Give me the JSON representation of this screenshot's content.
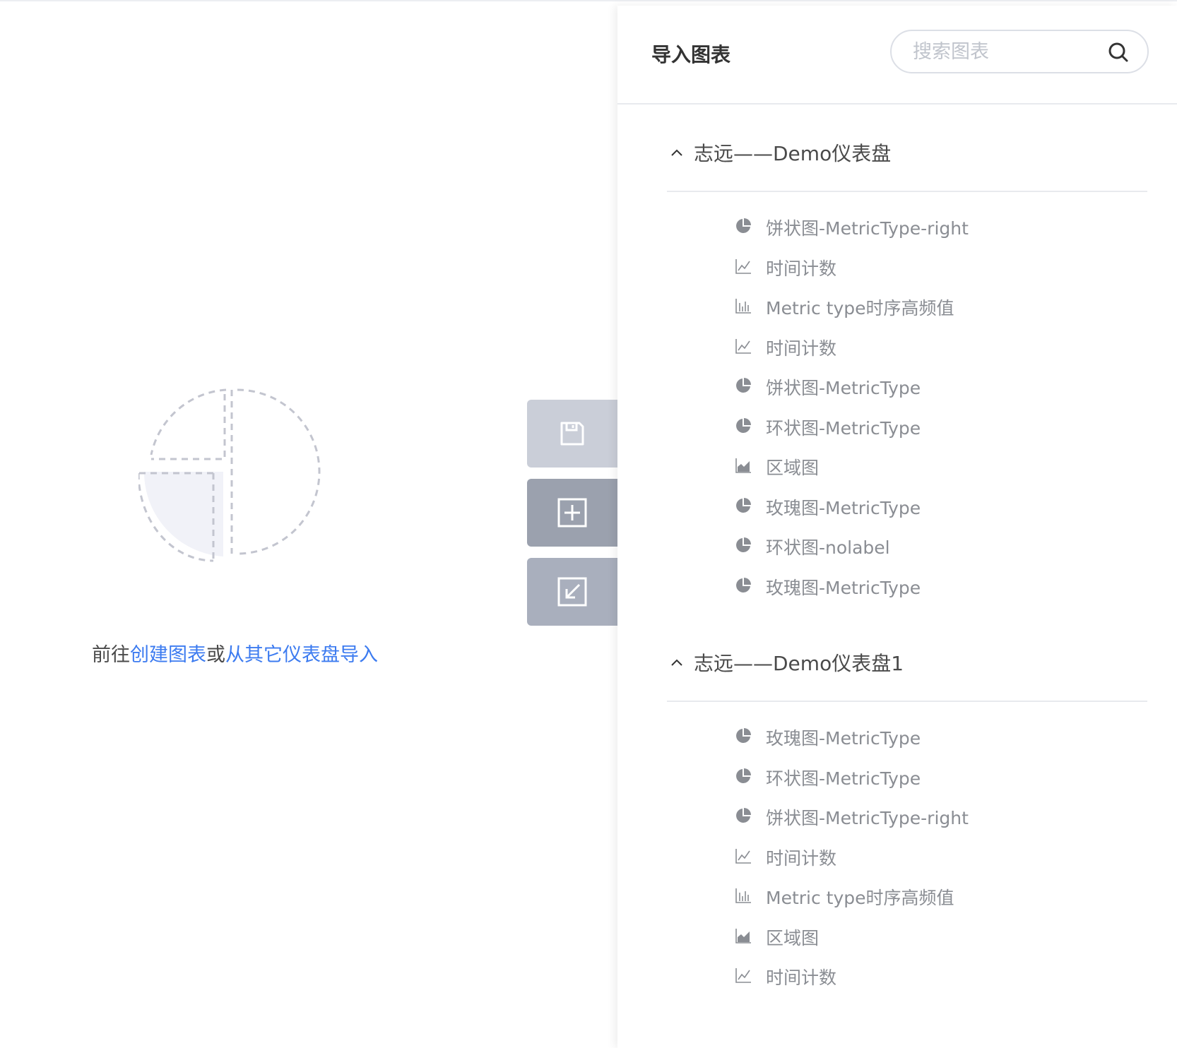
{
  "empty_state": {
    "prefix": "前往",
    "create_link": "创建图表",
    "or_text": "或",
    "import_link": "从其它仪表盘导入"
  },
  "toolbar": {
    "buttons": [
      {
        "icon": "save-icon"
      },
      {
        "icon": "plus-square-icon"
      },
      {
        "icon": "import-arrow-icon"
      }
    ]
  },
  "panel": {
    "title": "导入图表",
    "search": {
      "placeholder": "搜索图表",
      "value": ""
    },
    "groups": [
      {
        "title": "志远——Demo仪表盘",
        "expanded": true,
        "items": [
          {
            "label": "饼状图-MetricType-right",
            "icon": "pie-icon"
          },
          {
            "label": "时间计数",
            "icon": "line-chart-icon"
          },
          {
            "label": "Metric type时序高频值",
            "icon": "bar-chart-icon"
          },
          {
            "label": "时间计数",
            "icon": "line-chart-icon"
          },
          {
            "label": "饼状图-MetricType",
            "icon": "pie-icon"
          },
          {
            "label": "环状图-MetricType",
            "icon": "pie-icon"
          },
          {
            "label": "区域图",
            "icon": "area-chart-icon"
          },
          {
            "label": "玫瑰图-MetricType",
            "icon": "pie-icon"
          },
          {
            "label": "环状图-nolabel",
            "icon": "pie-icon"
          },
          {
            "label": "玫瑰图-MetricType",
            "icon": "pie-icon"
          }
        ]
      },
      {
        "title": "志远——Demo仪表盘1",
        "expanded": true,
        "items": [
          {
            "label": "玫瑰图-MetricType",
            "icon": "pie-icon"
          },
          {
            "label": "环状图-MetricType",
            "icon": "pie-icon"
          },
          {
            "label": "饼状图-MetricType-right",
            "icon": "pie-icon"
          },
          {
            "label": "时间计数",
            "icon": "line-chart-icon"
          },
          {
            "label": "Metric type时序高频值",
            "icon": "bar-chart-icon"
          },
          {
            "label": "区域图",
            "icon": "area-chart-icon"
          },
          {
            "label": "时间计数",
            "icon": "line-chart-icon"
          }
        ]
      }
    ]
  },
  "colors": {
    "link": "#3c7bf0",
    "icon_gray": "#8a8d93",
    "save_button_bg": "#caced8",
    "add_button_bg": "#9ba1ae",
    "import_button_bg": "#a9afbd"
  }
}
